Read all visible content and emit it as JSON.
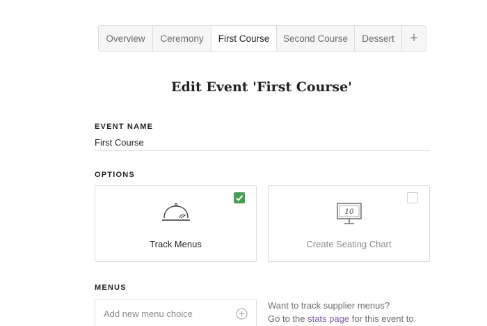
{
  "tabs": [
    {
      "label": "Overview",
      "active": false
    },
    {
      "label": "Ceremony",
      "active": false
    },
    {
      "label": "First Course",
      "active": true
    },
    {
      "label": "Second Course",
      "active": false
    },
    {
      "label": "Dessert",
      "active": false
    }
  ],
  "add_tab_label": "+",
  "page_title": "Edit Event 'First Course'",
  "event_name": {
    "label": "EVENT NAME",
    "value": "First Course"
  },
  "options": {
    "label": "OPTIONS",
    "track_menus": {
      "label": "Track Menus",
      "checked": true,
      "icon": "cloche-icon"
    },
    "seating_chart": {
      "label": "Create Seating Chart",
      "checked": false,
      "icon": "table-number-icon",
      "table_number": "10"
    }
  },
  "menus": {
    "label": "MENUS",
    "add_placeholder": "Add new menu choice",
    "help_line1": "Want to track supplier menus?",
    "help_line2_prefix": "Go to the ",
    "help_link": "stats page",
    "help_line2_suffix": " for this event to"
  },
  "colors": {
    "accent_green": "#4a9a5a",
    "link_purple": "#7b5ea8"
  }
}
